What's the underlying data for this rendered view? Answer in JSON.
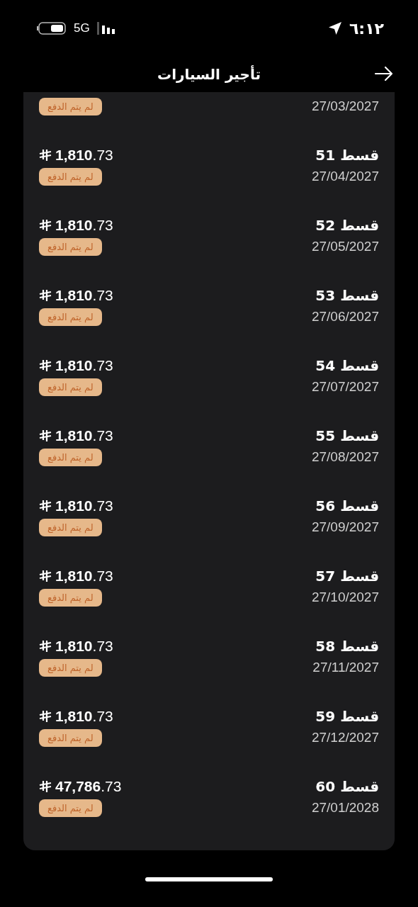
{
  "status_bar": {
    "time": "٦:١٢",
    "network": "5G"
  },
  "header": {
    "title": "تأجير السيارات"
  },
  "installments": [
    {
      "date": "27/03/2027",
      "status": "لم يتم الدفع"
    },
    {
      "title": "قسط 51",
      "date": "27/04/2027",
      "amount": "**1,810**.73",
      "status": "لم يتم الدفع"
    },
    {
      "title": "قسط 52",
      "date": "27/05/2027",
      "amount": "**1,810**.73",
      "status": "لم يتم الدفع"
    },
    {
      "title": "قسط 53",
      "date": "27/06/2027",
      "amount": "**1,810**.73",
      "status": "لم يتم الدفع"
    },
    {
      "title": "قسط 54",
      "date": "27/07/2027",
      "amount": "**1,810**.73",
      "status": "لم يتم الدفع"
    },
    {
      "title": "قسط 55",
      "date": "27/08/2027",
      "amount": "**1,810**.73",
      "status": "لم يتم الدفع"
    },
    {
      "title": "قسط 56",
      "date": "27/09/2027",
      "amount": "**1,810**.73",
      "status": "لم يتم الدفع"
    },
    {
      "title": "قسط 57",
      "date": "27/10/2027",
      "amount": "**1,810**.73",
      "status": "لم يتم الدفع"
    },
    {
      "title": "قسط 58",
      "date": "27/11/2027",
      "amount": "**1,810**.73",
      "status": "لم يتم الدفع"
    },
    {
      "title": "قسط 59",
      "date": "27/12/2027",
      "amount": "**1,810**.73",
      "status": "لم يتم الدفع"
    },
    {
      "title": "قسط 60",
      "date": "27/01/2028",
      "amount": "**47,786**.73",
      "status": "لم يتم الدفع"
    }
  ]
}
